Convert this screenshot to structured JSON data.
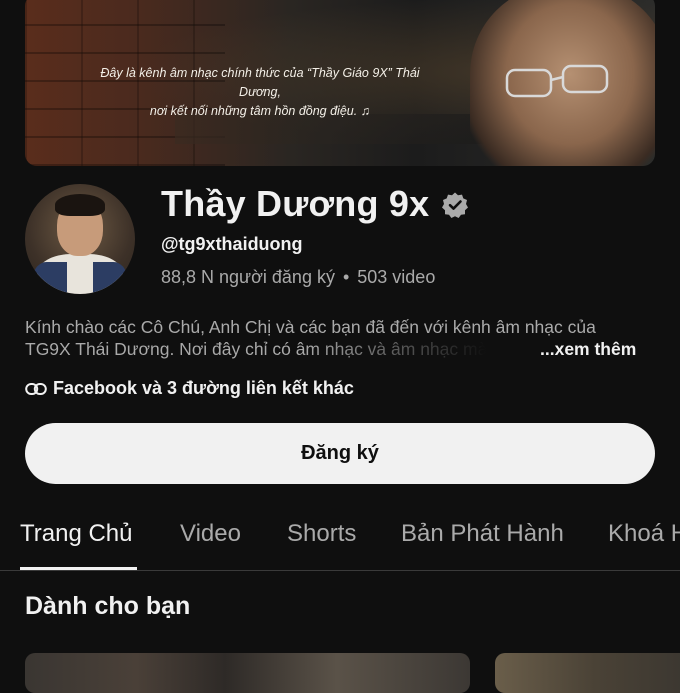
{
  "banner": {
    "line1": "Đây là kênh âm nhạc chính thức của “Thầy Giáo 9X” Thái Dương,",
    "line2": "nơi kết nối những tâm hồn đồng điệu. ♫"
  },
  "channel": {
    "name": "Thầy Dương 9x",
    "handle": "@tg9xthaiduong",
    "subscribers": "88,8 N người đăng ký",
    "separator": "•",
    "videos": "503 video",
    "description_line1": "Kính chào các Cô Chú, Anh Chị và các bạn đã đến với kênh âm nhạc của",
    "description_line2": "TG9X Thái Dương. Nơi đây chỉ có âm nhạc và âm nhạc mà",
    "more_label": "...xem thêm",
    "links_label": "Facebook và 3 đường liên kết khác",
    "subscribe_label": "Đăng ký"
  },
  "tabs": [
    {
      "label": "Trang Chủ",
      "active": true
    },
    {
      "label": "Video",
      "active": false
    },
    {
      "label": "Shorts",
      "active": false
    },
    {
      "label": "Bản Phát Hành",
      "active": false
    },
    {
      "label": "Khoá H",
      "active": false
    }
  ],
  "section": {
    "title": "Dành cho bạn"
  },
  "colors": {
    "background": "#0f0f0f",
    "text_primary": "#f1f1f1",
    "text_secondary": "#aaaaaa",
    "button_bg": "#f1f1f1"
  },
  "icons": [
    "verified-badge-icon",
    "link-icon"
  ]
}
